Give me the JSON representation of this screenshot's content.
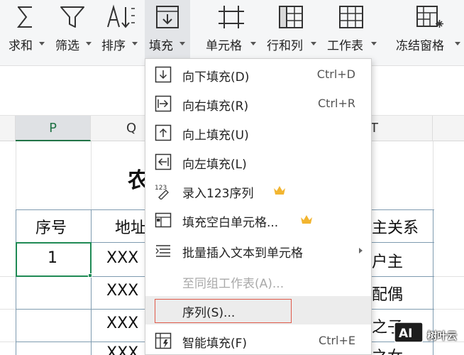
{
  "toolbar": {
    "items": [
      {
        "label": "求和",
        "icon": "sigma-icon"
      },
      {
        "label": "筛选",
        "icon": "filter-icon"
      },
      {
        "label": "排序",
        "icon": "sort-icon"
      },
      {
        "label": "填充",
        "icon": "fill-icon"
      },
      {
        "label": "单元格",
        "icon": "cell-icon"
      },
      {
        "label": "行和列",
        "icon": "rows-columns-icon"
      },
      {
        "label": "工作表",
        "icon": "worksheet-icon"
      },
      {
        "label": "冻结窗格",
        "icon": "freeze-panes-icon"
      }
    ]
  },
  "sheet": {
    "columns": [
      "P",
      "Q",
      "T"
    ],
    "title_fragment": "农",
    "header_row": {
      "seq": "序号",
      "addr": "地址",
      "relation": "主关系"
    },
    "rows": [
      {
        "seq": "1",
        "addr": "XXX",
        "relation": "户主"
      },
      {
        "seq": "",
        "addr": "XXX",
        "relation": "配偶"
      },
      {
        "seq": "",
        "addr": "XXX",
        "relation": "之子"
      },
      {
        "seq": "",
        "addr": "XXX",
        "relation": "之女"
      }
    ]
  },
  "menu": {
    "items": [
      {
        "label": "向下填充(D)",
        "shortcut": "Ctrl+D",
        "icon": "fill-down-icon"
      },
      {
        "label": "向右填充(R)",
        "shortcut": "Ctrl+R",
        "icon": "fill-right-icon"
      },
      {
        "label": "向上填充(U)",
        "shortcut": "",
        "icon": "fill-up-icon"
      },
      {
        "label": "向左填充(L)",
        "shortcut": "",
        "icon": "fill-left-icon"
      },
      {
        "label": "录入123序列",
        "shortcut": "",
        "icon": "sequence-123-icon",
        "premium": true
      },
      {
        "label": "填充空白单元格...",
        "shortcut": "",
        "icon": "fill-blank-icon",
        "premium": true
      },
      {
        "label": "批量插入文本到单元格",
        "shortcut": "",
        "icon": "batch-insert-icon",
        "submenu": true
      },
      {
        "label": "至同组工作表(A)...",
        "shortcut": "",
        "icon": "",
        "disabled": true
      },
      {
        "label": "序列(S)...",
        "shortcut": "",
        "icon": "",
        "highlighted": true
      },
      {
        "label": "智能填充(F)",
        "shortcut": "Ctrl+E",
        "icon": "smart-fill-icon"
      }
    ]
  },
  "watermark": {
    "text": "树叶云",
    "logo_text": "AI"
  },
  "colors": {
    "accent": "#1f8a55",
    "focus_box": "#e05a4a",
    "crown": "#f2b530",
    "table_border": "#7f9bb0"
  }
}
